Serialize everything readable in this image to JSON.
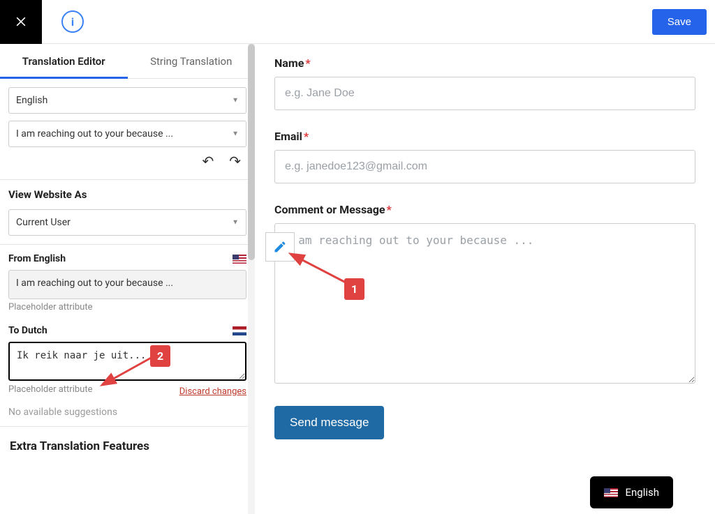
{
  "topbar": {
    "save_label": "Save"
  },
  "tabs": {
    "editor": "Translation Editor",
    "string": "String Translation"
  },
  "lang_select": {
    "value": "English"
  },
  "string_select": {
    "value": "I am reaching out to your because ..."
  },
  "view_as": {
    "title": "View Website As",
    "value": "Current User"
  },
  "from": {
    "label": "From English",
    "text": "I am reaching out to your because ...",
    "hint": "Placeholder attribute"
  },
  "to": {
    "label": "To Dutch",
    "text": "Ik reik naar je uit...",
    "hint": "Placeholder attribute",
    "discard": "Discard changes"
  },
  "no_suggestions": "No available suggestions",
  "extra_heading": "Extra Translation Features",
  "form": {
    "name_label": "Name",
    "name_placeholder": "e.g. Jane Doe",
    "email_label": "Email",
    "email_placeholder": "e.g. janedoe123@gmail.com",
    "msg_label": "Comment or Message",
    "msg_placeholder": "I am reaching out to your because ...",
    "submit": "Send message"
  },
  "callouts": {
    "one": "1",
    "two": "2"
  },
  "lang_switch": {
    "label": "English"
  }
}
